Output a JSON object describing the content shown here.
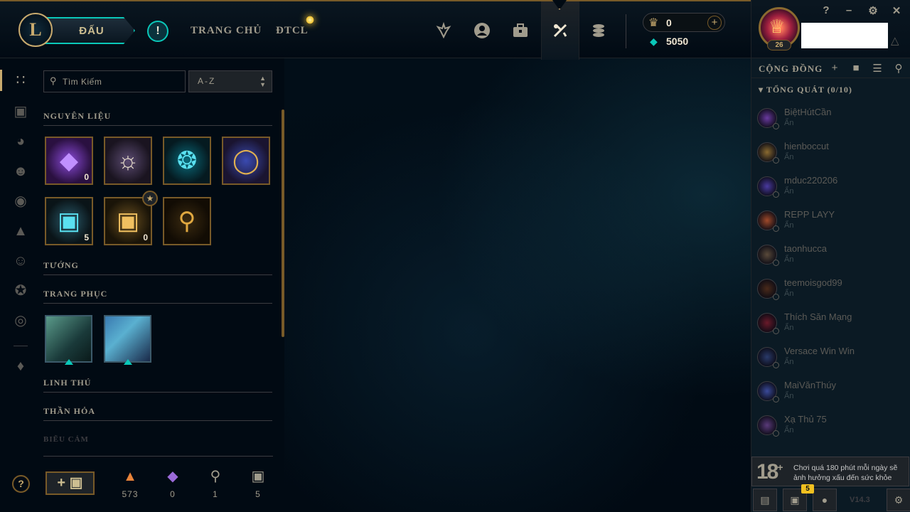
{
  "topbar": {
    "logo_letter": "L",
    "play_label": "ĐẤU",
    "alert_glyph": "!",
    "nav": {
      "home": "TRANG CHỦ",
      "tft": "ĐTCL"
    },
    "icons": [
      "ranked-icon",
      "profile-icon",
      "collection-icon",
      "loot-icon",
      "store-icon"
    ],
    "rp_value": "0",
    "be_value": "5050"
  },
  "social": {
    "level": "26",
    "title": "CỘNG ĐỒNG",
    "group_label": "TỔNG QUÁT (0/10)",
    "friends": [
      {
        "name": "BiệtHútCần",
        "status": "Ẩn",
        "color": "#6a3aa0"
      },
      {
        "name": "hienboccut",
        "status": "Ẩn",
        "color": "#8a6a30"
      },
      {
        "name": "mduc220206",
        "status": "Ẩn",
        "color": "#4a3aa0"
      },
      {
        "name": "REPP LAYY",
        "status": "Ẩn",
        "color": "#a04a2a"
      },
      {
        "name": "taonhucca",
        "status": "Ẩn",
        "color": "#5a4a3a"
      },
      {
        "name": "teemoisgod99",
        "status": "Ẩn",
        "color": "#4a2a1a"
      },
      {
        "name": "Thích Săn Mạng",
        "status": "Ẩn",
        "color": "#6a1a2a"
      },
      {
        "name": "Versace Win Win",
        "status": "Ẩn",
        "color": "#2a3a6a"
      },
      {
        "name": "MaiVănThúy",
        "status": "Ẩn",
        "color": "#3a4a9a"
      },
      {
        "name": "Xạ Thủ 75",
        "status": "Ẩn",
        "color": "#5a3a7a"
      }
    ],
    "warning_age": "18",
    "warning_plus": "+",
    "warning_text": "Chơi quá 180 phút mỗi ngày sẽ ảnh hưởng xấu đến sức khỏe",
    "mission_count": "5",
    "version": "V14.3"
  },
  "collection": {
    "search_placeholder": "Tìm Kiếm",
    "sort_value": "A-Z",
    "sections": {
      "materials": "NGUYÊN LIỆU",
      "champions": "TƯỚNG",
      "skins": "TRANG PHỤC",
      "companions": "LINH THÚ",
      "summoner": "THẦN HỎA",
      "emotes": "BIỂU CẢM"
    },
    "materials": [
      {
        "count": "0"
      },
      {
        "count": ""
      },
      {
        "count": ""
      },
      {
        "count": ""
      },
      {
        "count": "5"
      },
      {
        "count": "0"
      },
      {
        "count": ""
      }
    ]
  },
  "footer": {
    "add_label": "+",
    "stats": [
      {
        "icon": "orange-essence-icon",
        "value": "573",
        "color": "#e8843a"
      },
      {
        "icon": "mythic-essence-icon",
        "value": "0",
        "color": "#9a6ad8"
      },
      {
        "icon": "key-fragment-icon",
        "value": "1",
        "color": "#a09b8c"
      },
      {
        "icon": "chest-icon",
        "value": "5",
        "color": "#a09b8c"
      }
    ]
  }
}
